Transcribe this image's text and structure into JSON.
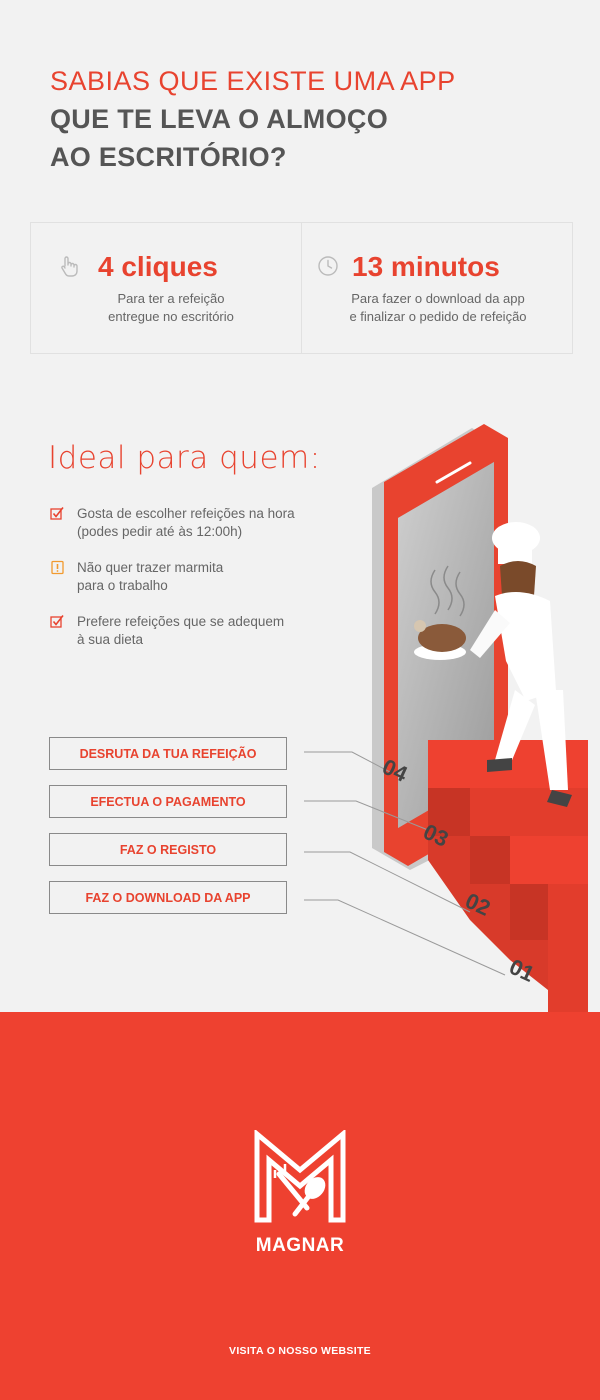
{
  "headline": {
    "line1": "SABIAS QUE EXISTE UMA APP",
    "line2": "QUE TE LEVA O ALMOÇO",
    "line3": "AO ESCRITÓRIO?"
  },
  "stats": [
    {
      "icon": "hand-pointer-icon",
      "value": "4 cliques",
      "desc_line1": "Para ter a refeição",
      "desc_line2": "entregue no escritório"
    },
    {
      "icon": "clock-icon",
      "value": "13 minutos",
      "desc_line1": "Para fazer o download da app",
      "desc_line2": "e finalizar o pedido de refeição"
    }
  ],
  "ideal": {
    "title": "Ideal para quem:",
    "items": [
      {
        "icon": "checkbox-icon",
        "line1": "Gosta de escolher refeições na hora",
        "line2": "(podes pedir até às 12:00h)"
      },
      {
        "icon": "warning-icon",
        "line1": "Não quer trazer marmita",
        "line2": "para o trabalho"
      },
      {
        "icon": "checkbox-icon",
        "line1": "Prefere refeições que se adequem",
        "line2": "à sua dieta"
      }
    ]
  },
  "steps": [
    {
      "label": "DESRUTA DA TUA REFEIÇÃO",
      "number": "04"
    },
    {
      "label": "EFECTUA O PAGAMENTO",
      "number": "03"
    },
    {
      "label": "FAZ O REGISTO",
      "number": "02"
    },
    {
      "label": "FAZ O DOWNLOAD DA APP",
      "number": "01"
    }
  ],
  "footer": {
    "brand": "MAGNAR",
    "website_label": "VISITA O NOSSO WEBSITE"
  },
  "colors": {
    "accent": "#ee4130",
    "text_dark": "#555555",
    "text_body": "#666666",
    "background": "#f2f2f2"
  }
}
